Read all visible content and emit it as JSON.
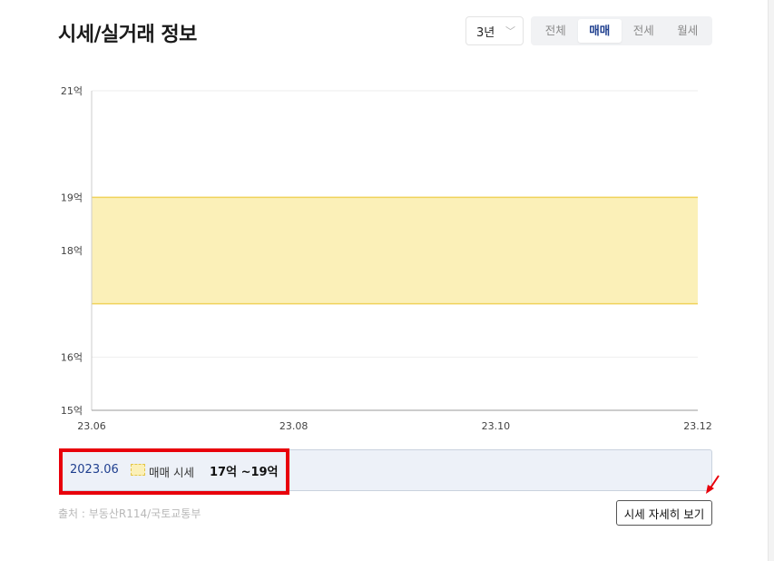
{
  "header": {
    "title": "시세/실거래 정보",
    "period": "3년",
    "tabs": [
      {
        "label": "전체",
        "active": false
      },
      {
        "label": "매매",
        "active": true
      },
      {
        "label": "전세",
        "active": false
      },
      {
        "label": "월세",
        "active": false
      }
    ]
  },
  "chart_data": {
    "type": "area",
    "series": [
      {
        "name": "매매 시세",
        "low": 17,
        "high": 19,
        "color": "#fbf0b8",
        "edge": "#f0d35a"
      }
    ],
    "x_ticks": [
      "23.06",
      "23.08",
      "23.10",
      "23.12"
    ],
    "y_ticks": [
      {
        "label": "15억",
        "value": 15
      },
      {
        "label": "16억",
        "value": 16
      },
      {
        "label": "18억",
        "value": 18
      },
      {
        "label": "19억",
        "value": 19
      },
      {
        "label": "21억",
        "value": 21
      }
    ],
    "ylim": [
      15,
      21
    ],
    "grid": true
  },
  "info": {
    "date": "2023.06",
    "label": "매매 시세",
    "range": "17억 ~19억"
  },
  "footer": {
    "source": "출처 : 부동산R114/국토교통부",
    "detail_button": "시세 자세히 보기"
  },
  "colors": {
    "accent": "#1f3f8f",
    "highlight": "#e8000b"
  }
}
